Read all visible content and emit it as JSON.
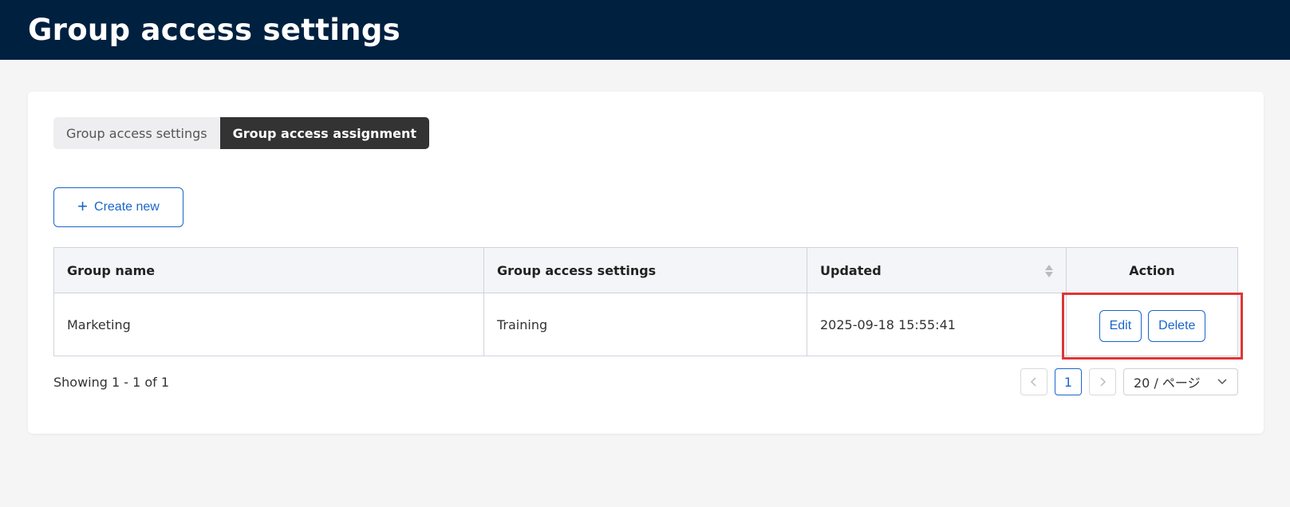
{
  "header": {
    "title": "Group access settings"
  },
  "tabs": [
    {
      "label": "Group access settings",
      "active": false
    },
    {
      "label": "Group access assignment",
      "active": true
    }
  ],
  "toolbar": {
    "create_label": "Create new",
    "create_icon": "plus-icon"
  },
  "table": {
    "columns": [
      "Group name",
      "Group access settings",
      "Updated",
      "Action"
    ],
    "rows": [
      {
        "group_name": "Marketing",
        "settings": "Training",
        "updated": "2025-09-18 15:55:41",
        "edit_label": "Edit",
        "delete_label": "Delete"
      }
    ]
  },
  "footer": {
    "showing": "Showing 1 - 1 of 1",
    "current_page": "1",
    "page_size": "20 / ページ",
    "prev_icon": "chevron-left-icon",
    "next_icon": "chevron-right-icon"
  },
  "colors": {
    "header_bg": "#00203f",
    "accent": "#1a66c9",
    "active_tab": "#333333",
    "highlight": "#e03535"
  }
}
